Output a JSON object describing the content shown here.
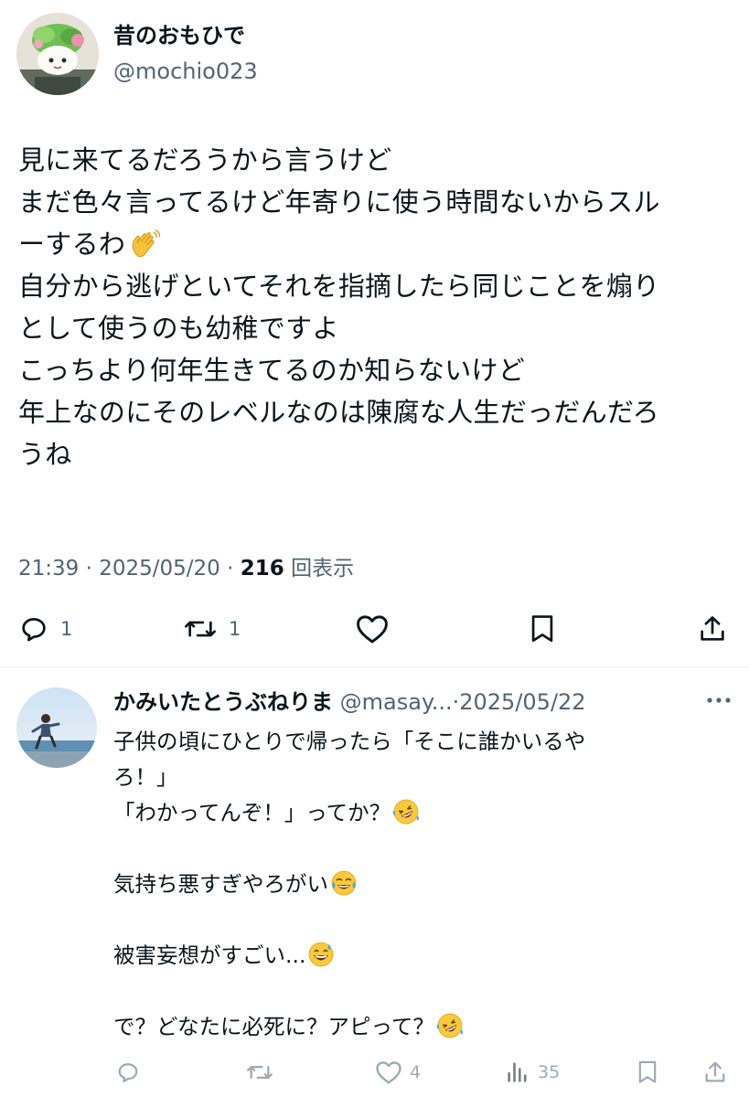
{
  "tweet": {
    "display_name": "昔のおもひで",
    "handle": "@mochio023",
    "lines": [
      "見に来てるだろうから言うけど",
      "まだ色々言ってるけど年寄りに使う時間ないからスル",
      "ーするわ",
      "自分から逃げといてそれを指摘したら同じことを煽り",
      "として使うのも幼稚ですよ",
      "こっちより何年生きてるのか知らないけど",
      "年上なのにそのレベルなのは陳腐な人生だっだんだろ",
      "うね"
    ],
    "time": "21:39",
    "date": "2025/05/20",
    "views": "216",
    "views_label": "回表示",
    "reply_count": "1",
    "retweet_count": "1"
  },
  "reply": {
    "display_name": "かみいたとうぶねりま",
    "handle": "@masay...",
    "date": "2025/05/22",
    "lines": [
      "子供の頃にひとりで帰ったら「そこに誰かいるや",
      "ろ！」",
      "「わかってんぞ！」ってか？",
      "",
      "気持ち悪すぎやろがい",
      "",
      "被害妄想がすごい...",
      "",
      "で？どなたに必死に？アピって？"
    ],
    "like_count": "4",
    "views_count": "35"
  },
  "icons": {
    "emoji_wave": "waving-hand",
    "emoji_rofl": "rolling-on-floor-laughing",
    "emoji_joy": "tears-of-joy",
    "emoji_sweat": "grinning-sweat"
  },
  "colors": {
    "text": "#0f1419",
    "secondary": "#536471",
    "divider": "#eff3f4",
    "background": "#ffffff"
  }
}
